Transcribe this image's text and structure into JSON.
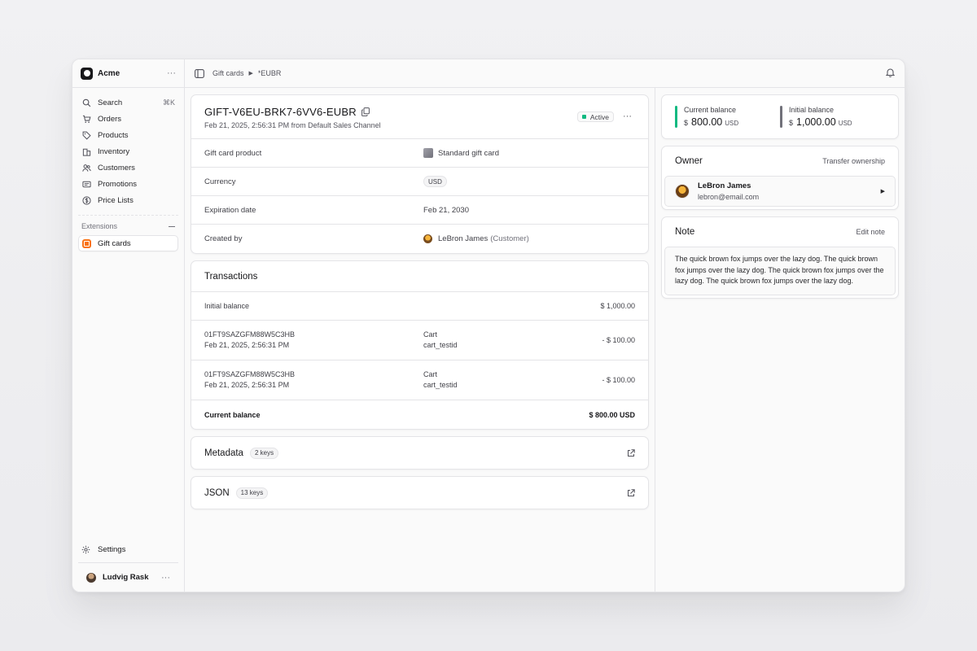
{
  "store": {
    "name": "Acme"
  },
  "sidebar": {
    "items": [
      {
        "label": "Search",
        "shortcut": "⌘K",
        "icon": "search-icon"
      },
      {
        "label": "Orders",
        "icon": "cart-icon"
      },
      {
        "label": "Products",
        "icon": "tag-icon"
      },
      {
        "label": "Inventory",
        "icon": "building-icon"
      },
      {
        "label": "Customers",
        "icon": "users-icon"
      },
      {
        "label": "Promotions",
        "icon": "receipt-icon"
      },
      {
        "label": "Price Lists",
        "icon": "currency-icon"
      }
    ],
    "extensions_label": "Extensions",
    "extension_item": "Gift cards",
    "settings_label": "Settings",
    "user_name": "Ludvig Rask"
  },
  "breadcrumb": {
    "parent": "Gift cards",
    "current": "*EUBR"
  },
  "gift_card": {
    "code": "GIFT-V6EU-BRK7-6VV6-EUBR",
    "subtitle": "Feb 21, 2025, 2:56:31 PM from Default Sales Channel",
    "status": "Active",
    "status_color": "#10b981",
    "rows": {
      "product_label": "Gift card product",
      "product_value": "Standard gift card",
      "currency_label": "Currency",
      "currency_value": "USD",
      "expiration_label": "Expiration date",
      "expiration_value": "Feb 21, 2030",
      "created_label": "Created by",
      "created_value": "LeBron James",
      "created_role": "(Customer)"
    }
  },
  "transactions": {
    "title": "Transactions",
    "initial_label": "Initial balance",
    "initial_amount": "$ 1,000.00",
    "rows": [
      {
        "id": "01FT9SAZGFM88W5C3HB",
        "date": "Feb 21, 2025, 2:56:31 PM",
        "type": "Cart",
        "ref": "cart_testid",
        "amount": "- $ 100.00"
      },
      {
        "id": "01FT9SAZGFM88W5C3HB",
        "date": "Feb 21, 2025, 2:56:31 PM",
        "type": "Cart",
        "ref": "cart_testid",
        "amount": "- $ 100.00"
      }
    ],
    "current_label": "Current balance",
    "current_amount": "$ 800.00 USD"
  },
  "metadata": {
    "title": "Metadata",
    "keys": "2 keys"
  },
  "json": {
    "title": "JSON",
    "keys": "13 keys"
  },
  "balances": {
    "current_label": "Current balance",
    "current_symbol": "$",
    "current_amount": "800.00",
    "current_code": "USD",
    "current_color": "#10b981",
    "initial_label": "Initial balance",
    "initial_symbol": "$",
    "initial_amount": "1,000.00",
    "initial_code": "USD",
    "initial_color": "#71717a"
  },
  "owner": {
    "title": "Owner",
    "action": "Transfer ownership",
    "name": "LeBron James",
    "email": "lebron@email.com"
  },
  "note": {
    "title": "Note",
    "action": "Edit note",
    "text": "The quick brown fox jumps over the lazy dog. The quick brown fox jumps over the lazy dog. The quick brown fox jumps over the lazy dog. The quick brown fox jumps over the lazy dog."
  }
}
